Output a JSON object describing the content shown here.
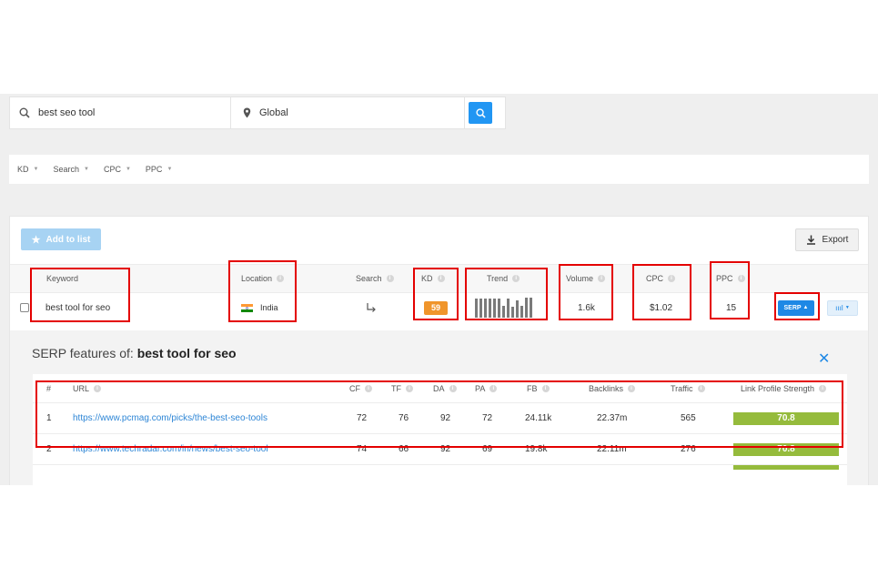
{
  "search": {
    "keyword": "best seo tool",
    "location": "Global"
  },
  "filters": [
    {
      "label": "KD"
    },
    {
      "label": "Search"
    },
    {
      "label": "CPC"
    },
    {
      "label": "PPC"
    }
  ],
  "toolbar": {
    "add_to_list": "Add to list",
    "export": "Export"
  },
  "table": {
    "headers": {
      "keyword": "Keyword",
      "location": "Location",
      "search": "Search",
      "kd": "KD",
      "trend": "Trend",
      "volume": "Volume",
      "cpc": "CPC",
      "ppc": "PPC"
    },
    "row": {
      "keyword": "best tool for seo",
      "location": "India",
      "search_icon": "arrow-turn-down-right-icon",
      "kd": "59",
      "trend": [
        0.95,
        0.95,
        0.95,
        0.95,
        0.95,
        0.95,
        0.6,
        0.95,
        0.55,
        0.85,
        0.6,
        1.0,
        1.0
      ],
      "volume": "1.6k",
      "cpc": "$1.02",
      "ppc": "15",
      "serp_label": "SERP",
      "chart_label": "ıııl"
    }
  },
  "serp": {
    "title_prefix": "SERP features of: ",
    "title_keyword": "best tool for seo",
    "headers": {
      "num": "#",
      "url": "URL",
      "cf": "CF",
      "tf": "TF",
      "da": "DA",
      "pa": "PA",
      "fb": "FB",
      "backlinks": "Backlinks",
      "traffic": "Traffic",
      "lps": "Link Profile Strength"
    },
    "rows": [
      {
        "num": "1",
        "url": "https://www.pcmag.com/picks/the-best-seo-tools",
        "cf": "72",
        "tf": "76",
        "da": "92",
        "pa": "72",
        "fb": "24.11k",
        "backlinks": "22.37m",
        "traffic": "565",
        "lps": "70.8"
      },
      {
        "num": "2",
        "url": "https://www.techradar.com/in/news/best-seo-tool",
        "cf": "74",
        "tf": "66",
        "da": "92",
        "pa": "69",
        "fb": "19.8k",
        "backlinks": "22.11m",
        "traffic": "276",
        "lps": "70.8"
      }
    ]
  },
  "colors": {
    "accent": "#2196f3",
    "kd": "#f0952b",
    "lps": "#95bb3c",
    "highlight": "#e40000"
  }
}
